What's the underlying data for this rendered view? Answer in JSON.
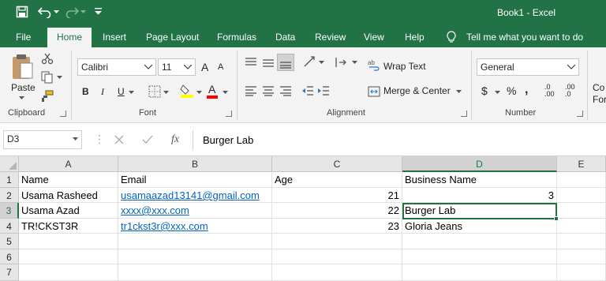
{
  "titlebar": {
    "title": "Book1  -  Excel"
  },
  "tabs": [
    {
      "label": "File"
    },
    {
      "label": "Home"
    },
    {
      "label": "Insert"
    },
    {
      "label": "Page Layout"
    },
    {
      "label": "Formulas"
    },
    {
      "label": "Data"
    },
    {
      "label": "Review"
    },
    {
      "label": "View"
    },
    {
      "label": "Help"
    }
  ],
  "tell_me": "Tell me what you want to do",
  "ribbon": {
    "clipboard": {
      "paste": "Paste",
      "label": "Clipboard"
    },
    "font": {
      "name": "Calibri",
      "size": "11",
      "grow": "A",
      "shrink": "A",
      "bold": "B",
      "italic": "I",
      "underline": "U",
      "font_color_letter": "A",
      "label": "Font"
    },
    "alignment": {
      "wrap_text": "Wrap Text",
      "merge_center": "Merge & Center",
      "label": "Alignment"
    },
    "number": {
      "format": "General",
      "currency": "$",
      "percent": "%",
      "comma": ",",
      "inc_dec": ".0\n.00",
      "dec_dec": ".00\n.0",
      "label": "Number"
    },
    "styles": {
      "partial1": "Co",
      "partial2": "For"
    }
  },
  "formula_bar": {
    "name_box": "D3",
    "fx": "fx",
    "value": "Burger Lab"
  },
  "sheet": {
    "columns": [
      "A",
      "B",
      "C",
      "D",
      "E"
    ],
    "rows": [
      "1",
      "2",
      "3",
      "4",
      "5",
      "6",
      "7"
    ],
    "cells": {
      "A1": "Name",
      "B1": "Email",
      "C1": "Age",
      "D1": "Business Name",
      "A2": "Usama Rasheed",
      "B2": "usamaazad13141@gmail.com",
      "C2": "21",
      "D2": "3",
      "A3": "Usama Azad",
      "B3": "xxxx@xxx.com",
      "C3": "22",
      "D3": "Burger Lab",
      "A4": "TR!CKST3R",
      "B4": "tr1ckst3r@xxx.com",
      "C4": "23",
      "D4": "Gloria Jeans"
    },
    "selected_cell": "D3"
  },
  "colors": {
    "brand": "#217346",
    "link": "#0563c1",
    "highlight_yellow": "#ffff00",
    "font_red": "#ff0000"
  }
}
